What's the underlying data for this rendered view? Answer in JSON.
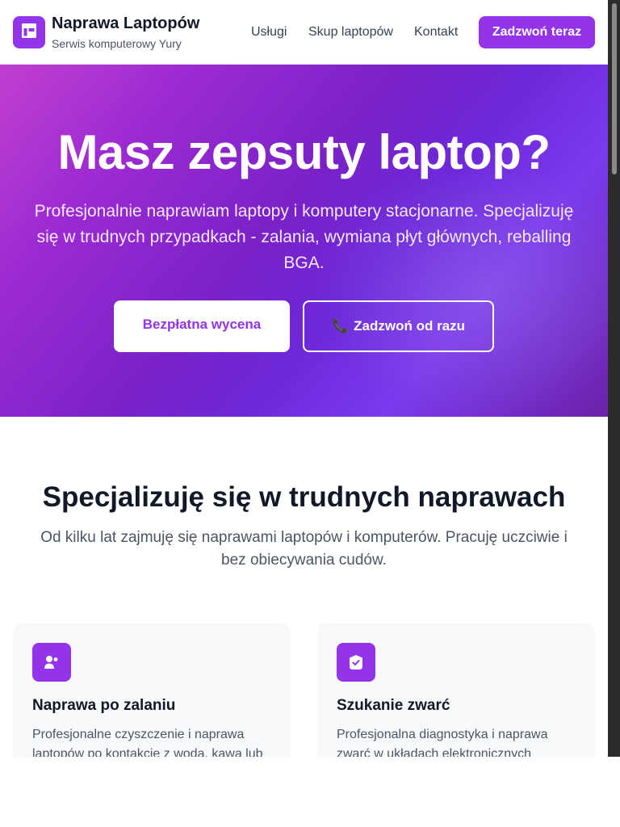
{
  "header": {
    "brand_title": "Naprawa Laptopów",
    "brand_subtitle": "Serwis komputerowy Yury",
    "logo_icon": "layout-icon",
    "nav": [
      "Usługi",
      "Skup laptopów",
      "Kontakt"
    ],
    "cta_label": "Zadzwoń teraz"
  },
  "hero": {
    "title": "Masz zepsuty laptop?",
    "text": "Profesjonalnie naprawiam laptopy i komputery stacjonarne. Specjalizuję się w trudnych przypadkach - zalania, wymiana płyt głównych, reballing BGA.",
    "primary_button": "Bezpłatna wycena",
    "secondary_button_icon": "📞",
    "secondary_button": "Zadzwoń od razu"
  },
  "features": {
    "title": "Specjalizuję się w trudnych naprawach",
    "subtitle": "Od kilku lat zajmuję się naprawami laptopów i komputerów. Pracuję uczciwie i bez obiecywania cudów.",
    "cards": [
      {
        "icon": "user-drop-icon",
        "title": "Naprawa po zalaniu",
        "description": "Profesjonalne czyszczenie i naprawa laptopów po kontakcie z wodą, kawą lub"
      },
      {
        "icon": "shield-check-icon",
        "title": "Szukanie zwarć",
        "description": "Profesjonalna diagnostyka i naprawa zwarć w układach elektronicznych"
      }
    ]
  },
  "colors": {
    "accent": "#9333ea",
    "hero_gradient_start": "#c13fd0",
    "hero_gradient_end": "#6b21a8",
    "card_background": "#f8f9fb"
  }
}
